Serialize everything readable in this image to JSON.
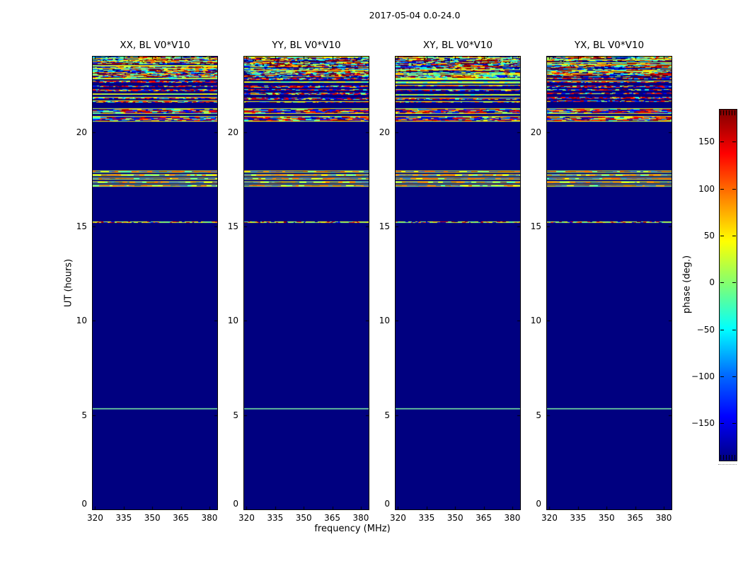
{
  "chart_data": {
    "type": "heatmap",
    "title": "2017-05-04 0.0-24.0",
    "xlabel": "frequency (MHz)",
    "ylabel": "UT (hours)",
    "value_label": "phase (deg.)",
    "colormap": "jet",
    "xlim": [
      318.7,
      384.1
    ],
    "ylim": [
      0,
      24
    ],
    "x_ticks": [
      320,
      335,
      350,
      365,
      380
    ],
    "x_tick_labels": [
      "320",
      "335",
      "350",
      "365",
      "380"
    ],
    "y_ticks": [
      0,
      5,
      10,
      15,
      20
    ],
    "y_tick_labels": [
      "0",
      "5",
      "10",
      "15",
      "20"
    ],
    "colorbar": {
      "ticks": [
        150,
        100,
        50,
        0,
        -50,
        -100,
        -150
      ],
      "tick_labels": [
        "150",
        "100",
        "50",
        "0",
        "−50",
        "−100",
        "−150"
      ],
      "range": [
        -180,
        180
      ],
      "extended_ends": true
    },
    "flagged_background_color": "#000080",
    "thin_line_color": "#84ffa6",
    "panels": [
      {
        "id": "XX",
        "title": "XX, BL V0*V10",
        "seed": 11
      },
      {
        "id": "YY",
        "title": "YY, BL V0*V10",
        "seed": 23
      },
      {
        "id": "XY",
        "title": "XY, BL V0*V10",
        "seed": 37
      },
      {
        "id": "YX",
        "title": "YX, BL V0*V10",
        "seed": 49
      }
    ],
    "bands": [
      {
        "ut_start": 22.88,
        "ut_end": 24.0,
        "kind": "dense",
        "desc": "dense multicolour phase noise across full band"
      },
      {
        "ut_start": 21.56,
        "ut_end": 22.88,
        "kind": "striped",
        "desc": "alternating noisy and flagged scan rows"
      },
      {
        "ut_start": 20.55,
        "ut_end": 21.26,
        "kind": "double-stripe",
        "desc": "two noisy stripes with pale green edges"
      },
      {
        "ut_start": 17.03,
        "ut_end": 17.96,
        "kind": "stripe-group",
        "desc": "five narrow noisy stripes"
      },
      {
        "ut_start": 15.15,
        "ut_end": 15.26,
        "kind": "thin-multicolor",
        "desc": "single mostly-green noisy scan line"
      },
      {
        "ut_start": 5.29,
        "ut_end": 5.36,
        "kind": "thin-green",
        "desc": "single scan line, phase near 0 deg"
      }
    ]
  }
}
